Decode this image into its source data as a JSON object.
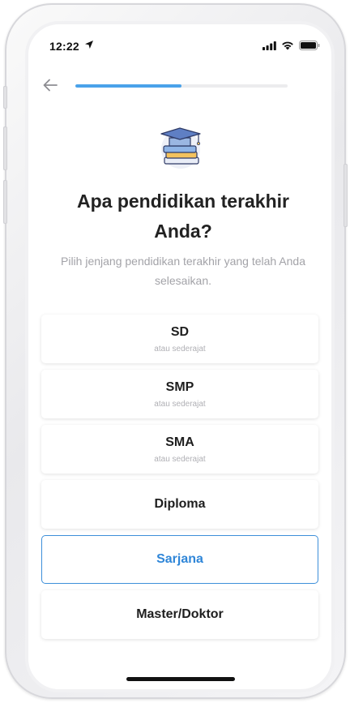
{
  "status_bar": {
    "time": "12:22",
    "icons": [
      "location-arrow-icon",
      "cellular-signal-icon",
      "wifi-icon",
      "battery-icon"
    ]
  },
  "nav": {
    "back_icon": "arrow-left-icon",
    "progress": 0.5,
    "progress_color": "#4aa2ea"
  },
  "illustration": "graduation-cap-books-icon",
  "question": {
    "title": "Apa pendidikan terakhir Anda?",
    "subtitle": "Pilih jenjang pendidikan terakhir yang telah Anda selesaikan."
  },
  "options": [
    {
      "label": "SD",
      "sub": "atau sederajat",
      "selected": false
    },
    {
      "label": "SMP",
      "sub": "atau sederajat",
      "selected": false
    },
    {
      "label": "SMA",
      "sub": "atau sederajat",
      "selected": false
    },
    {
      "label": "Diploma",
      "sub": "",
      "selected": false
    },
    {
      "label": "Sarjana",
      "sub": "",
      "selected": true
    },
    {
      "label": "Master/Doktor",
      "sub": "",
      "selected": false
    }
  ],
  "colors": {
    "accent": "#2f86d8",
    "title": "#222222",
    "muted": "#a3a3a8"
  }
}
